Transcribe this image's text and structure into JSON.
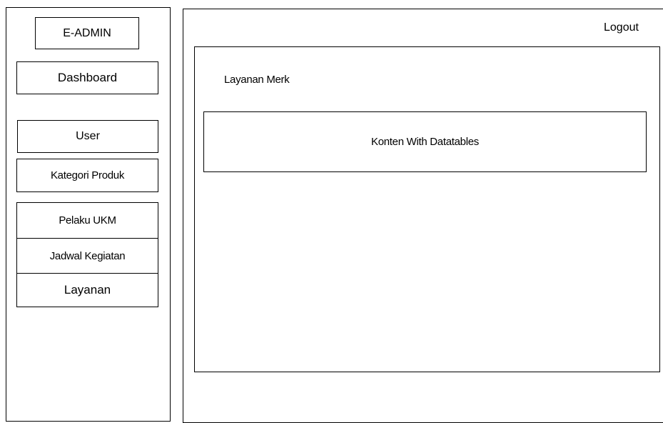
{
  "sidebar": {
    "brand": "E-ADMIN",
    "items": [
      {
        "label": "Dashboard"
      },
      {
        "label": "User"
      },
      {
        "label": "Kategori Produk"
      },
      {
        "label": "Pelaku UKM"
      },
      {
        "label": "Jadwal Kegiatan"
      },
      {
        "label": "Layanan"
      }
    ]
  },
  "header": {
    "logout_label": "Logout"
  },
  "main": {
    "page_title": "Layanan Merk",
    "content_placeholder": "Konten With Datatables"
  }
}
